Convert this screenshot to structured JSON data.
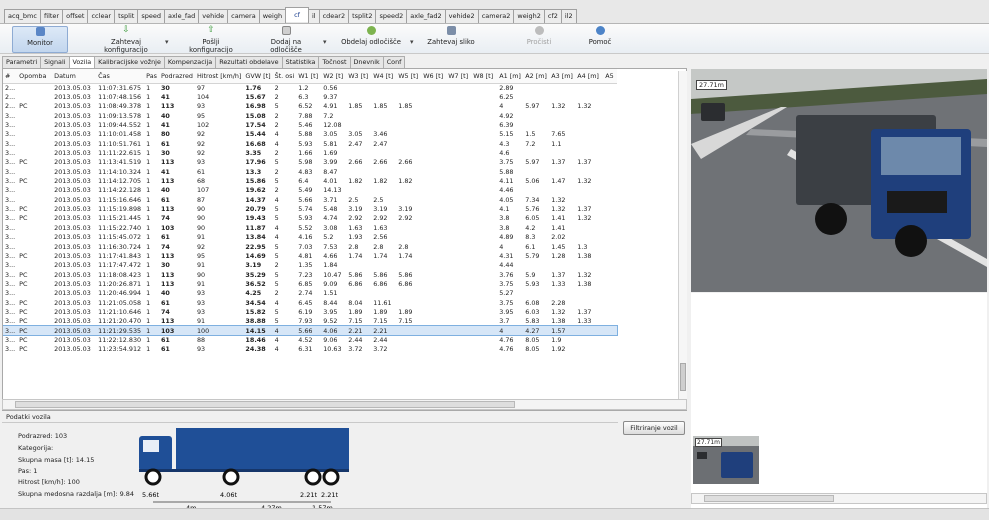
{
  "top_tabs": [
    "acq_bmc",
    "filter",
    "offset",
    "cclear",
    "tsplit",
    "speed",
    "axle_fad",
    "vehide",
    "camera",
    "weigh",
    "cf",
    "il",
    "cdear2",
    "tsplit2",
    "speed2",
    "axle_fad2",
    "vehide2",
    "camera2",
    "weigh2",
    "cf2",
    "il2"
  ],
  "toolbar": {
    "monitor": "Monitor",
    "save_config": "Zahtevaj konfiguracijo",
    "send_config": "Pošlji konfiguracijo",
    "add_reading": "Dodaj na odločišče",
    "process_reading": "Obdelaj odločišče",
    "request_image": "Zahtevaj sliko",
    "read": "Pročisti",
    "help": "Pomoč"
  },
  "sub_tabs": [
    "Parametri",
    "Signali",
    "Vozila",
    "Kalibracijske vožnje",
    "Kompenzacija",
    "Rezultati obdelave",
    "Statistika",
    "Točnost",
    "Dnevnik",
    "Conf"
  ],
  "columns": [
    "#",
    "Opomba",
    "Datum",
    "Čas",
    "Pas",
    "Podrazred",
    "Hitrost [km/h]",
    "GVW [t]",
    "Št. osi",
    "W1 [t]",
    "W2 [t]",
    "W3 [t]",
    "W4 [t]",
    "W5 [t]",
    "W6 [t]",
    "W7 [t]",
    "W8 [t]",
    "A1 [m]",
    "A2 [m]",
    "A3 [m]",
    "A4 [m]",
    "A5"
  ],
  "rows": [
    [
      "2...",
      "",
      "2013.05.03",
      "11:07:31.675",
      "1",
      "30",
      "97",
      "1.76",
      "2",
      "1.2",
      "0.56",
      "",
      "",
      "",
      "",
      "",
      "",
      "2.89",
      "",
      "",
      ""
    ],
    [
      "2...",
      "",
      "2013.05.03",
      "11:07:48.156",
      "1",
      "41",
      "104",
      "15.67",
      "2",
      "6.3",
      "9.37",
      "",
      "",
      "",
      "",
      "",
      "",
      "6.25",
      "",
      "",
      ""
    ],
    [
      "2...",
      "PC",
      "2013.05.03",
      "11:08:49.378",
      "1",
      "113",
      "93",
      "16.98",
      "5",
      "6.52",
      "4.91",
      "1.85",
      "1.85",
      "1.85",
      "",
      "",
      "",
      "4",
      "5.97",
      "1.32",
      "1.32"
    ],
    [
      "3...",
      "",
      "2013.05.03",
      "11:09:13.578",
      "1",
      "40",
      "95",
      "15.08",
      "2",
      "7.88",
      "7.2",
      "",
      "",
      "",
      "",
      "",
      "",
      "4.92",
      "",
      "",
      ""
    ],
    [
      "3...",
      "",
      "2013.05.03",
      "11:09:44.552",
      "1",
      "41",
      "102",
      "17.54",
      "2",
      "5.46",
      "12.08",
      "",
      "",
      "",
      "",
      "",
      "",
      "6.39",
      "",
      "",
      ""
    ],
    [
      "3...",
      "",
      "2013.05.03",
      "11:10:01.458",
      "1",
      "80",
      "92",
      "15.44",
      "4",
      "5.88",
      "3.05",
      "3.05",
      "3.46",
      "",
      "",
      "",
      "",
      "5.15",
      "1.5",
      "7.65",
      ""
    ],
    [
      "3...",
      "",
      "2013.05.03",
      "11:10:51.761",
      "1",
      "61",
      "92",
      "16.68",
      "4",
      "5.93",
      "5.81",
      "2.47",
      "2.47",
      "",
      "",
      "",
      "",
      "4.3",
      "7.2",
      "1.1",
      ""
    ],
    [
      "3...",
      "",
      "2013.05.03",
      "11:11:22.615",
      "1",
      "30",
      "92",
      "3.35",
      "2",
      "1.66",
      "1.69",
      "",
      "",
      "",
      "",
      "",
      "",
      "4.6",
      "",
      "",
      ""
    ],
    [
      "3...",
      "PC",
      "2013.05.03",
      "11:13:41.519",
      "1",
      "113",
      "93",
      "17.96",
      "5",
      "5.98",
      "3.99",
      "2.66",
      "2.66",
      "2.66",
      "",
      "",
      "",
      "3.75",
      "5.97",
      "1.37",
      "1.37"
    ],
    [
      "3...",
      "",
      "2013.05.03",
      "11:14:10.324",
      "1",
      "41",
      "61",
      "13.3",
      "2",
      "4.83",
      "8.47",
      "",
      "",
      "",
      "",
      "",
      "",
      "5.88",
      "",
      "",
      ""
    ],
    [
      "3...",
      "PC",
      "2013.05.03",
      "11:14:12.705",
      "1",
      "113",
      "68",
      "15.86",
      "5",
      "6.4",
      "4.01",
      "1.82",
      "1.82",
      "1.82",
      "",
      "",
      "",
      "4.11",
      "5.06",
      "1.47",
      "1.32"
    ],
    [
      "3...",
      "",
      "2013.05.03",
      "11:14:22.128",
      "1",
      "40",
      "107",
      "19.62",
      "2",
      "5.49",
      "14.13",
      "",
      "",
      "",
      "",
      "",
      "",
      "4.46",
      "",
      "",
      ""
    ],
    [
      "3...",
      "",
      "2013.05.03",
      "11:15:16.646",
      "1",
      "61",
      "87",
      "14.37",
      "4",
      "5.66",
      "3.71",
      "2.5",
      "2.5",
      "",
      "",
      "",
      "",
      "4.05",
      "7.34",
      "1.32",
      ""
    ],
    [
      "3...",
      "PC",
      "2013.05.03",
      "11:15:19.898",
      "1",
      "113",
      "90",
      "20.79",
      "5",
      "5.74",
      "5.48",
      "3.19",
      "3.19",
      "3.19",
      "",
      "",
      "",
      "4.1",
      "5.76",
      "1.32",
      "1.37"
    ],
    [
      "3...",
      "PC",
      "2013.05.03",
      "11:15:21.445",
      "1",
      "74",
      "90",
      "19.43",
      "5",
      "5.93",
      "4.74",
      "2.92",
      "2.92",
      "2.92",
      "",
      "",
      "",
      "3.8",
      "6.05",
      "1.41",
      "1.32"
    ],
    [
      "3...",
      "",
      "2013.05.03",
      "11:15:22.740",
      "1",
      "103",
      "90",
      "11.87",
      "4",
      "5.52",
      "3.08",
      "1.63",
      "1.63",
      "",
      "",
      "",
      "",
      "3.8",
      "4.2",
      "1.41",
      ""
    ],
    [
      "3...",
      "",
      "2013.05.03",
      "11:15:45.072",
      "1",
      "61",
      "91",
      "13.84",
      "4",
      "4.16",
      "5.2",
      "1.93",
      "2.56",
      "",
      "",
      "",
      "",
      "4.89",
      "8.3",
      "2.02",
      ""
    ],
    [
      "3...",
      "",
      "2013.05.03",
      "11:16:30.724",
      "1",
      "74",
      "92",
      "22.95",
      "5",
      "7.03",
      "7.53",
      "2.8",
      "2.8",
      "2.8",
      "",
      "",
      "",
      "4",
      "6.1",
      "1.45",
      "1.3"
    ],
    [
      "3...",
      "PC",
      "2013.05.03",
      "11:17:41.843",
      "1",
      "113",
      "95",
      "14.69",
      "5",
      "4.81",
      "4.66",
      "1.74",
      "1.74",
      "1.74",
      "",
      "",
      "",
      "4.31",
      "5.79",
      "1.28",
      "1.38"
    ],
    [
      "3...",
      "",
      "2013.05.03",
      "11:17:47.472",
      "1",
      "30",
      "91",
      "3.19",
      "2",
      "1.35",
      "1.84",
      "",
      "",
      "",
      "",
      "",
      "",
      "4.44",
      "",
      "",
      ""
    ],
    [
      "3...",
      "PC",
      "2013.05.03",
      "11:18:08.423",
      "1",
      "113",
      "90",
      "35.29",
      "5",
      "7.23",
      "10.47",
      "5.86",
      "5.86",
      "5.86",
      "",
      "",
      "",
      "3.76",
      "5.9",
      "1.37",
      "1.32"
    ],
    [
      "3...",
      "PC",
      "2013.05.03",
      "11:20:26.871",
      "1",
      "113",
      "91",
      "36.52",
      "5",
      "6.85",
      "9.09",
      "6.86",
      "6.86",
      "6.86",
      "",
      "",
      "",
      "3.75",
      "5.93",
      "1.33",
      "1.38"
    ],
    [
      "3...",
      "",
      "2013.05.03",
      "11:20:46.994",
      "1",
      "40",
      "93",
      "4.25",
      "2",
      "2.74",
      "1.51",
      "",
      "",
      "",
      "",
      "",
      "",
      "5.27",
      "",
      "",
      ""
    ],
    [
      "3...",
      "PC",
      "2013.05.03",
      "11:21:05.058",
      "1",
      "61",
      "93",
      "34.54",
      "4",
      "6.45",
      "8.44",
      "8.04",
      "11.61",
      "",
      "",
      "",
      "",
      "3.75",
      "6.08",
      "2.28",
      ""
    ],
    [
      "3...",
      "PC",
      "2013.05.03",
      "11:21:10.646",
      "1",
      "74",
      "93",
      "15.82",
      "5",
      "6.19",
      "3.95",
      "1.89",
      "1.89",
      "1.89",
      "",
      "",
      "",
      "3.95",
      "6.03",
      "1.32",
      "1.37"
    ],
    [
      "3...",
      "PC",
      "2013.05.03",
      "11:21:20.470",
      "1",
      "113",
      "91",
      "38.88",
      "5",
      "7.93",
      "9.52",
      "7.15",
      "7.15",
      "7.15",
      "",
      "",
      "",
      "3.7",
      "5.83",
      "1.38",
      "1.33"
    ],
    [
      "3...",
      "PC",
      "2013.05.03",
      "11:21:29.535",
      "1",
      "103",
      "100",
      "14.15",
      "4",
      "5.66",
      "4.06",
      "2.21",
      "2.21",
      "",
      "",
      "",
      "",
      "4",
      "4.27",
      "1.57",
      ""
    ],
    [
      "3...",
      "PC",
      "2013.05.03",
      "11:22:12.830",
      "1",
      "61",
      "88",
      "18.46",
      "4",
      "4.52",
      "9.06",
      "2.44",
      "2.44",
      "",
      "",
      "",
      "",
      "4.76",
      "8.05",
      "1.9",
      ""
    ],
    [
      "3...",
      "PC",
      "2013.05.03",
      "11:23:54.912",
      "1",
      "61",
      "93",
      "24.38",
      "4",
      "6.31",
      "10.63",
      "3.72",
      "3.72",
      "",
      "",
      "",
      "",
      "4.76",
      "8.05",
      "1.92",
      ""
    ]
  ],
  "selected_row": 26,
  "vehicle_data": {
    "title": "Podatki vozila",
    "subclass": "Podrazred: 103",
    "category": "Kategorija:",
    "gross_mass": "Skupna masa [t]: 14.15",
    "lane": "Pas: 1",
    "speed": "Hitrost [km/h]: 100",
    "axle_distance": "Skupna medosna razdalja [m]: 9.84",
    "axle_weights": [
      "5.66t",
      "4.06t",
      "2.21t",
      "2.21t"
    ],
    "axle_spacings": [
      "4m",
      "4.27m",
      "1.57m"
    ],
    "filter_button": "Filtriranje vozil"
  },
  "camera": {
    "main_label": "27.71m",
    "thumb_label": "27.71m"
  },
  "colors": {
    "truck": "#1f4f97",
    "accent": "#1a3e8f",
    "selected_row": "#d6e6f7"
  }
}
